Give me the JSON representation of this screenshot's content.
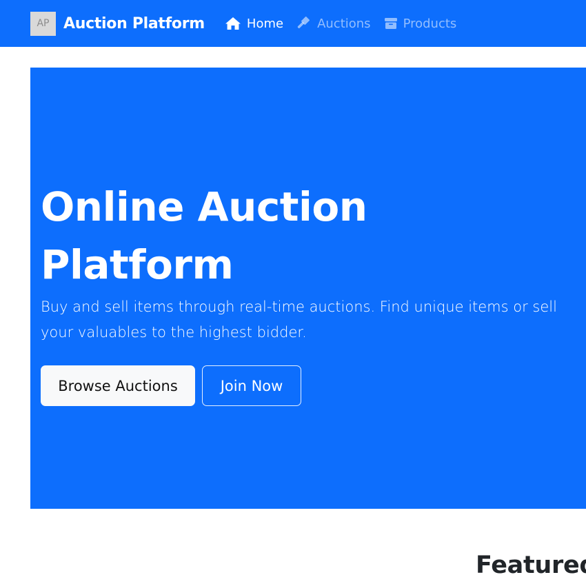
{
  "navbar": {
    "logo_text": "AP",
    "brand_name": "Auction Platform",
    "links": [
      {
        "label": "Home",
        "icon": "house-icon",
        "active": true
      },
      {
        "label": "Auctions",
        "icon": "gavel-icon",
        "active": false
      },
      {
        "label": "Products",
        "icon": "box-icon",
        "active": false
      }
    ]
  },
  "hero": {
    "title": "Online Auction Platform",
    "lead": "Buy and sell items through real-time auctions. Find unique items or sell your valuables to the highest bidder.",
    "primary_button": "Browse Auctions",
    "secondary_button": "Join Now"
  },
  "featured_heading": "Featured",
  "colors": {
    "primary": "#0d6efd",
    "light": "#f8f9fa",
    "text_dark": "#212529"
  }
}
